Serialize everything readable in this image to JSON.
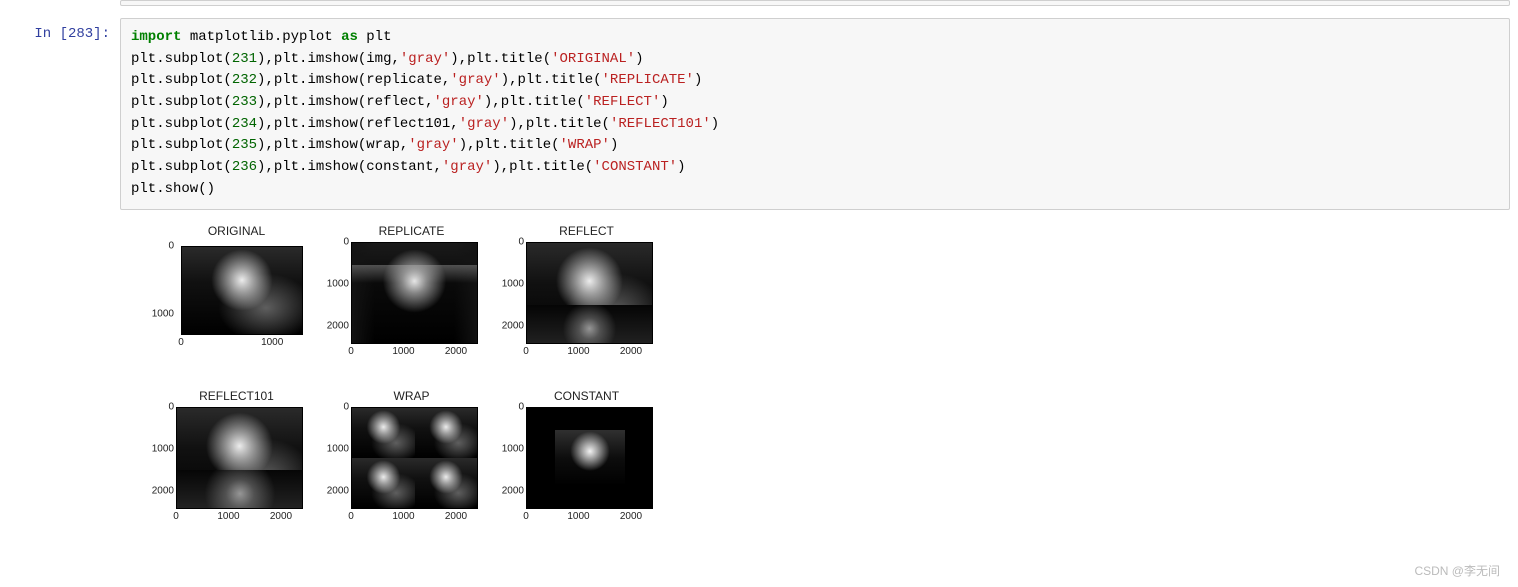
{
  "prompt": {
    "label": "In ",
    "number": "[283]:"
  },
  "code": {
    "l1": {
      "a": "import",
      "b": " matplotlib.pyplot ",
      "c": "as",
      "d": " plt"
    },
    "l2": {
      "pre": "plt.subplot(",
      "n": "231",
      "mid": "),plt.imshow(img,",
      "s": "'gray'",
      "mid2": "),plt.title(",
      "s2": "'ORIGINAL'",
      "end": ")"
    },
    "l3": {
      "pre": "plt.subplot(",
      "n": "232",
      "mid": "),plt.imshow(replicate,",
      "s": "'gray'",
      "mid2": "),plt.title(",
      "s2": "'REPLICATE'",
      "end": ")"
    },
    "l4": {
      "pre": "plt.subplot(",
      "n": "233",
      "mid": "),plt.imshow(reflect,",
      "s": "'gray'",
      "mid2": "),plt.title(",
      "s2": "'REFLECT'",
      "end": ")"
    },
    "l5": {
      "pre": "plt.subplot(",
      "n": "234",
      "mid": "),plt.imshow(reflect101,",
      "s": "'gray'",
      "mid2": "),plt.title(",
      "s2": "'REFLECT101'",
      "end": ")"
    },
    "l6": {
      "pre": "plt.subplot(",
      "n": "235",
      "mid": "),plt.imshow(wrap,",
      "s": "'gray'",
      "mid2": "),plt.title(",
      "s2": "'WRAP'",
      "end": ")"
    },
    "l7": {
      "pre": "plt.subplot(",
      "n": "236",
      "mid": "),plt.imshow(constant,",
      "s": "'gray'",
      "mid2": "),plt.title(",
      "s2": "'CONSTANT'",
      "end": ")"
    },
    "l8": "plt.show()"
  },
  "plots": {
    "p1": {
      "title": "ORIGINAL",
      "yticks": [
        "0",
        "1000"
      ],
      "xticks": [
        "0",
        "1000"
      ]
    },
    "p2": {
      "title": "REPLICATE",
      "yticks": [
        "0",
        "1000",
        "2000"
      ],
      "xticks": [
        "0",
        "1000",
        "2000"
      ]
    },
    "p3": {
      "title": "REFLECT",
      "yticks": [
        "0",
        "1000",
        "2000"
      ],
      "xticks": [
        "0",
        "1000",
        "2000"
      ]
    },
    "p4": {
      "title": "REFLECT101",
      "yticks": [
        "0",
        "1000",
        "2000"
      ],
      "xticks": [
        "0",
        "1000",
        "2000"
      ]
    },
    "p5": {
      "title": "WRAP",
      "yticks": [
        "0",
        "1000",
        "2000"
      ],
      "xticks": [
        "0",
        "1000",
        "2000"
      ]
    },
    "p6": {
      "title": "CONSTANT",
      "yticks": [
        "0",
        "1000",
        "2000"
      ],
      "xticks": [
        "0",
        "1000",
        "2000"
      ]
    }
  },
  "watermark": "CSDN @李无间"
}
